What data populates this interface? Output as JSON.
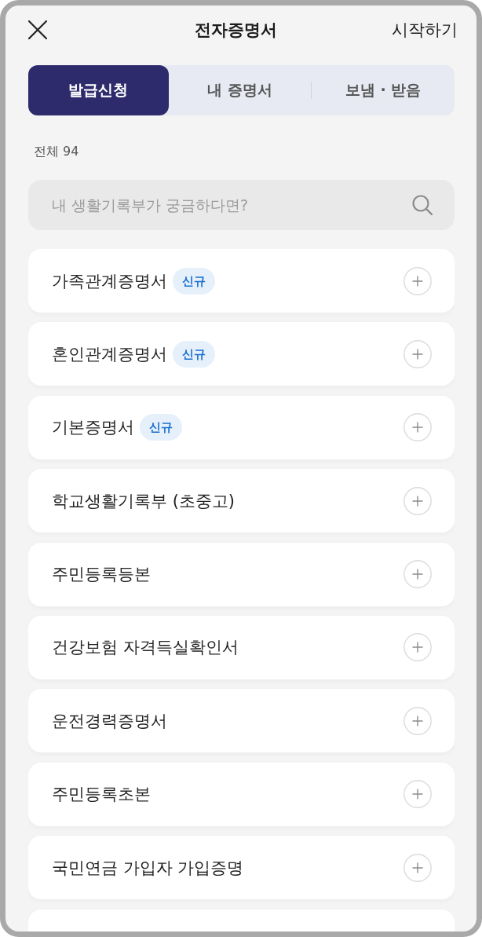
{
  "header": {
    "title": "전자증명서",
    "action": "시작하기"
  },
  "tabs": [
    {
      "label": "발급신청",
      "selected": true
    },
    {
      "label": "내 증명서",
      "selected": false
    },
    {
      "label": "보냄 · 받음",
      "selected": false
    }
  ],
  "total": "전체 94",
  "search": {
    "placeholder": "내 생활기록부가 궁금하다면?"
  },
  "certificates": [
    {
      "name": "가족관계증명서",
      "badge": "신규"
    },
    {
      "name": "혼인관계증명서",
      "badge": "신규"
    },
    {
      "name": "기본증명서",
      "badge": "신규"
    },
    {
      "name": "학교생활기록부 (초중고)"
    },
    {
      "name": "주민등록등본"
    },
    {
      "name": "건강보험 자격득실확인서"
    },
    {
      "name": "운전경력증명서"
    },
    {
      "name": "주민등록초본"
    },
    {
      "name": "국민연금 가입자 가입증명"
    }
  ]
}
